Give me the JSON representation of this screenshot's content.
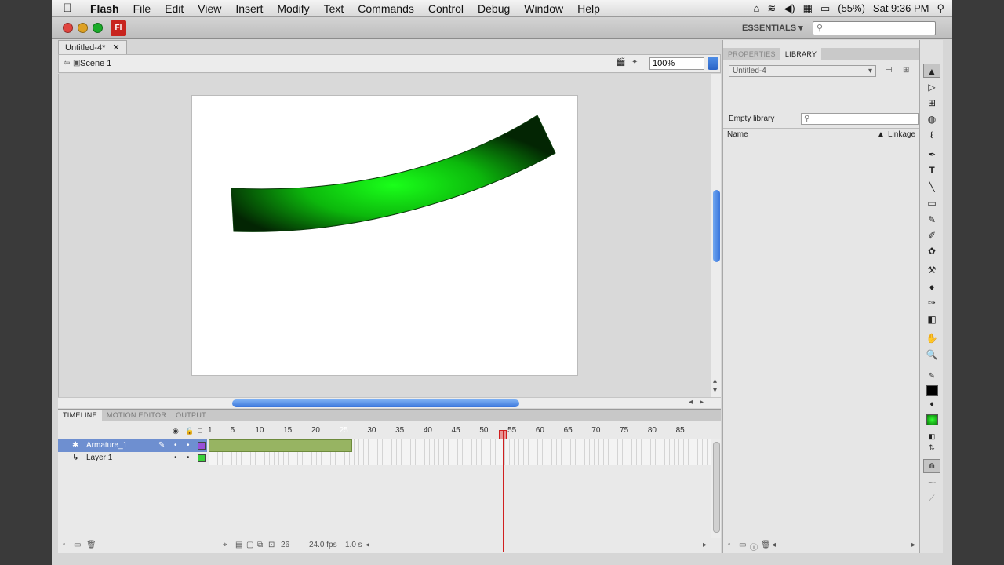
{
  "menubar": {
    "app_name": "Flash",
    "items": [
      "File",
      "Edit",
      "View",
      "Insert",
      "Modify",
      "Text",
      "Commands",
      "Control",
      "Debug",
      "Window",
      "Help"
    ],
    "battery": "(55%)",
    "clock": "Sat 9:36 PM"
  },
  "appbar": {
    "logo_text": "Fl",
    "workspace": "ESSENTIALS ▾",
    "traffic_colors": [
      "#e0443e",
      "#dea123",
      "#1aab29"
    ]
  },
  "document": {
    "tab_title": "Untitled-4*",
    "scene": "Scene 1",
    "zoom": "100%"
  },
  "timeline": {
    "tabs": [
      "TIMELINE",
      "MOTION EDITOR",
      "OUTPUT"
    ],
    "ruler": [
      "1",
      "5",
      "10",
      "15",
      "20",
      "25",
      "30",
      "35",
      "40",
      "45",
      "50",
      "55",
      "60",
      "65",
      "70",
      "75",
      "80",
      "85"
    ],
    "layers": [
      {
        "name": "Armature_1",
        "color": "#9a50d8"
      },
      {
        "name": "Layer 1",
        "color": "#3ad13a"
      }
    ],
    "status": {
      "frame": "26",
      "fps": "24.0 fps",
      "time": "1.0 s"
    }
  },
  "panel": {
    "tabs": [
      "PROPERTIES",
      "LIBRARY"
    ],
    "library_doc": "Untitled-4",
    "empty_label": "Empty library",
    "col_name": "Name",
    "col_linkage": "Linkage"
  },
  "tools": [
    "▲",
    "▷",
    "⊞",
    "◍",
    "ℓ",
    "✒",
    "T",
    "╲",
    "▭",
    "✎",
    "✐",
    "✿",
    "⚒",
    "♦",
    "✑",
    "◧",
    "✋",
    "🔍"
  ]
}
